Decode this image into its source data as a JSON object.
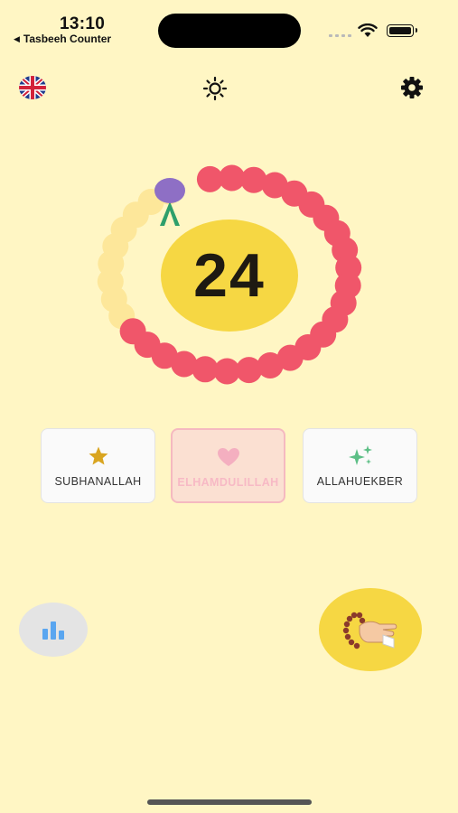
{
  "status_bar": {
    "time": "13:10",
    "back_app": "Tasbeeh Counter"
  },
  "toolbar": {
    "language_icon": "uk-flag-icon",
    "theme_icon": "sun-icon",
    "settings_icon": "gear-icon"
  },
  "counter": {
    "value": "24"
  },
  "beads": {
    "total": 33,
    "completed": 24,
    "completed_color": "#F0566A",
    "remaining_color": "#FDE79A",
    "marker_color": "#8E6FC5",
    "tassel_color": "#2E9F6B"
  },
  "dhikr_options": [
    {
      "label": "SUBHANALLAH",
      "icon": "star-icon",
      "color": "#D9A520",
      "selected": false
    },
    {
      "label": "ELHAMDULILLAH",
      "icon": "heart-icon",
      "color": "#F4AFC0",
      "selected": true
    },
    {
      "label": "ALLAHUEKBER",
      "icon": "sparkles-icon",
      "color": "#5DBF86",
      "selected": false
    }
  ],
  "bottom": {
    "stats_icon": "bar-chart-icon",
    "tap_icon": "prayer-beads-hand-icon"
  },
  "colors": {
    "background": "#FFF6C4",
    "accent": "#F6D743"
  }
}
